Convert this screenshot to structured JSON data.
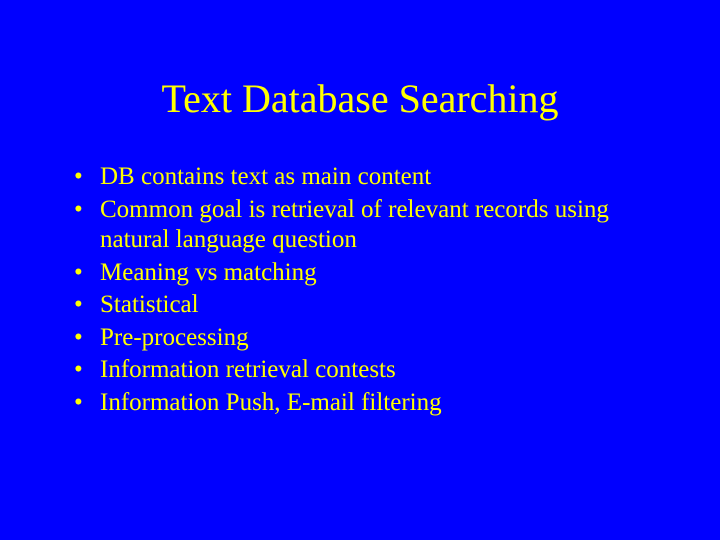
{
  "title": "Text Database Searching",
  "bullets": [
    "DB contains text as main content",
    "Common goal is retrieval of relevant records using natural language question",
    "Meaning vs matching",
    "Statistical",
    "Pre-processing",
    "Information retrieval contests",
    "Information Push, E-mail filtering"
  ]
}
